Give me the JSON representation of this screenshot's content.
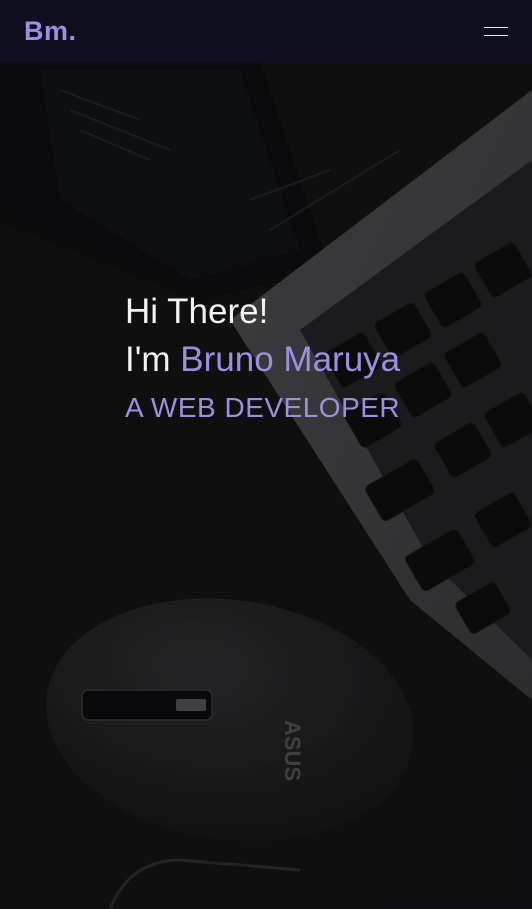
{
  "navbar": {
    "brand": "Bm.",
    "menu_icon": "hamburger-menu-icon"
  },
  "hero": {
    "greeting": "Hi There!",
    "intro_prefix": "I'm ",
    "name": "Bruno Maruya",
    "role": "A WEB DEVELOPER"
  },
  "colors": {
    "accent": "#9d8fe0",
    "navbar_bg": "#0f0e1e",
    "text": "#f2f2f2"
  }
}
